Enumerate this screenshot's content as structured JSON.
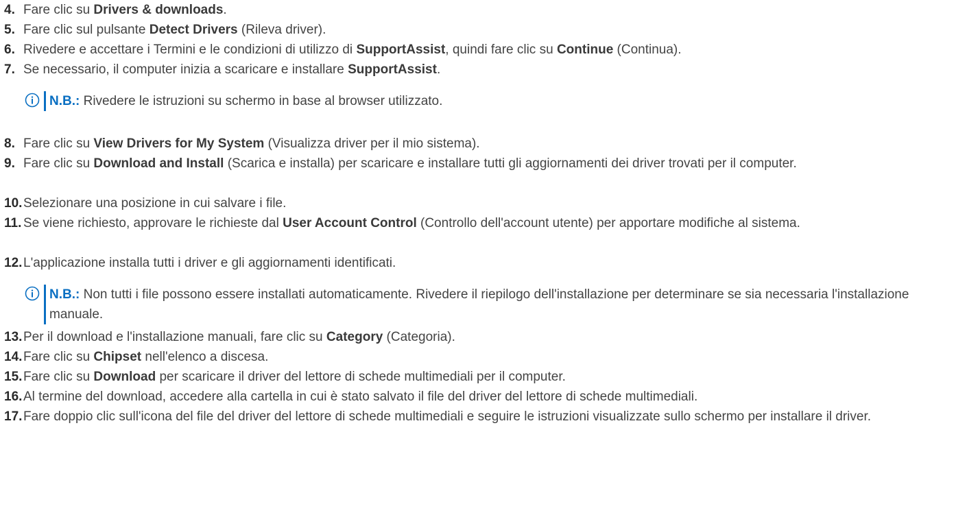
{
  "steps": [
    {
      "num": "4.",
      "parts": [
        {
          "t": "Fare clic su "
        },
        {
          "b": "Drivers & downloads"
        },
        {
          "t": "."
        }
      ]
    },
    {
      "num": "5.",
      "parts": [
        {
          "t": "Fare clic sul pulsante "
        },
        {
          "b": "Detect Drivers"
        },
        {
          "t": " (Rileva driver)."
        }
      ]
    },
    {
      "num": "6.",
      "parts": [
        {
          "t": "Rivedere e accettare i Termini e le condizioni di utilizzo di "
        },
        {
          "b": "SupportAssist"
        },
        {
          "t": ", quindi fare clic su "
        },
        {
          "b": "Continue"
        },
        {
          "t": " (Continua)."
        }
      ]
    },
    {
      "num": "7.",
      "parts": [
        {
          "t": "Se necessario, il computer inizia a scaricare e installare "
        },
        {
          "b": "SupportAssist"
        },
        {
          "t": "."
        }
      ]
    },
    {
      "num": "8.",
      "parts": [
        {
          "t": "Fare clic su "
        },
        {
          "b": "View Drivers for My System"
        },
        {
          "t": " (Visualizza driver per il mio sistema)."
        }
      ]
    },
    {
      "num": "9.",
      "parts": [
        {
          "t": "Fare clic su "
        },
        {
          "b": "Download and Install"
        },
        {
          "t": " (Scarica e installa) per scaricare e installare tutti gli aggiornamenti dei driver trovati per il computer."
        }
      ]
    },
    {
      "num": "10.",
      "parts": [
        {
          "t": "Selezionare una posizione in cui salvare i file."
        }
      ]
    },
    {
      "num": "11.",
      "parts": [
        {
          "t": "Se viene richiesto, approvare le richieste dal "
        },
        {
          "b": "User Account Control"
        },
        {
          "t": " (Controllo dell'account utente) per apportare modifiche al sistema."
        }
      ]
    },
    {
      "num": "12.",
      "parts": [
        {
          "t": "L'applicazione installa tutti i driver e gli aggiornamenti identificati."
        }
      ]
    },
    {
      "num": "13.",
      "parts": [
        {
          "t": "Per il download e l'installazione manuali, fare clic su "
        },
        {
          "b": "Category"
        },
        {
          "t": " (Categoria)."
        }
      ]
    },
    {
      "num": "14.",
      "parts": [
        {
          "t": "Fare clic su "
        },
        {
          "b": "Chipset"
        },
        {
          "t": " nell'elenco a discesa."
        }
      ]
    },
    {
      "num": "15.",
      "parts": [
        {
          "t": "Fare clic su "
        },
        {
          "b": "Download"
        },
        {
          "t": " per scaricare il driver del lettore di schede multimediali per il computer."
        }
      ]
    },
    {
      "num": "16.",
      "parts": [
        {
          "t": "Al termine del download, accedere alla cartella in cui è stato salvato il file del driver del lettore di schede multimediali."
        }
      ]
    },
    {
      "num": "17.",
      "parts": [
        {
          "t": "Fare doppio clic sull'icona del file del driver del lettore di schede multimediali e seguire le istruzioni visualizzate sullo schermo per installare il driver."
        }
      ]
    }
  ],
  "notes": [
    {
      "label": "N.B.:",
      "text": " Rivedere le istruzioni su schermo in base al browser utilizzato."
    },
    {
      "label": "N.B.:",
      "text": " Non tutti i file possono essere installati automaticamente. Rivedere il riepilogo dell'installazione per determinare se sia necessaria l'installazione manuale."
    }
  ],
  "colors": {
    "accent": "#0a6fc2",
    "text": "#444444"
  },
  "icons": {
    "note_icon": "info-icon"
  }
}
